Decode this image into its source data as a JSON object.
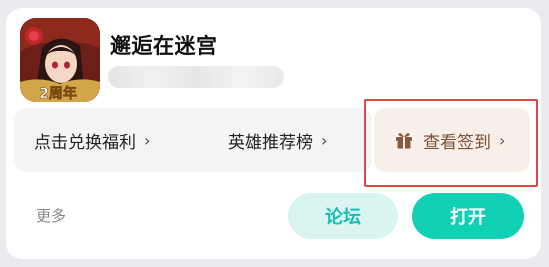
{
  "app": {
    "title": "邂逅在迷宫",
    "icon": "game-app-icon",
    "icon_badge_text": "2周年"
  },
  "quick_actions": [
    {
      "label": "点击兑换福利",
      "chevron": "›"
    },
    {
      "label": "英雄推荐榜",
      "chevron": "›"
    }
  ],
  "checkin": {
    "label": "查看签到",
    "chevron": "›",
    "icon": "gift-icon"
  },
  "footer": {
    "more_label": "更多",
    "forum_label": "论坛",
    "open_label": "打开"
  },
  "colors": {
    "accent": "#12d0b6",
    "accent_light": "#daf5f1",
    "accent_text": "#16bfae",
    "checkin_bg": "#f7efea",
    "checkin_text": "#7a4f34",
    "highlight_outline": "#e04848"
  }
}
